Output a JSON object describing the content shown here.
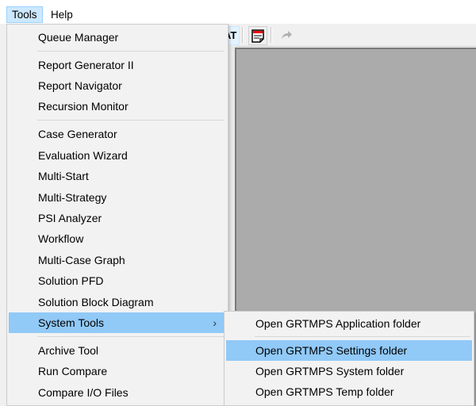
{
  "menubar": {
    "items": [
      {
        "label": "Tools",
        "active": true
      },
      {
        "label": "Help",
        "active": false
      }
    ]
  },
  "toolbar": {
    "buttons": [
      {
        "icon": "format-icon",
        "label": "AT"
      },
      {
        "icon": "notes-icon",
        "label": "NOTE"
      },
      {
        "icon": "redo-icon"
      }
    ]
  },
  "tools_menu": {
    "groups": [
      [
        "Queue Manager"
      ],
      [
        "Report Generator II",
        "Report Navigator",
        "Recursion Monitor"
      ],
      [
        "Case Generator",
        "Evaluation Wizard",
        "Multi-Start",
        "Multi-Strategy",
        "PSI Analyzer",
        "Workflow",
        "Multi-Case Graph",
        "Solution PFD",
        "Solution Block Diagram",
        "System Tools"
      ],
      [
        "Archive Tool",
        "Run Compare",
        "Compare I/O Files"
      ]
    ],
    "highlighted": "System Tools",
    "submenu_arrow": "›"
  },
  "system_tools_submenu": {
    "groups": [
      [
        "Open GRTMPS Application folder"
      ],
      [
        "Open GRTMPS Settings folder",
        "Open GRTMPS System folder",
        "Open GRTMPS Temp folder"
      ]
    ],
    "highlighted": "Open GRTMPS Settings folder"
  },
  "colors": {
    "menu_highlight": "#91c9f7",
    "menubar_active": "#cce8ff",
    "workspace": "#ababab"
  }
}
